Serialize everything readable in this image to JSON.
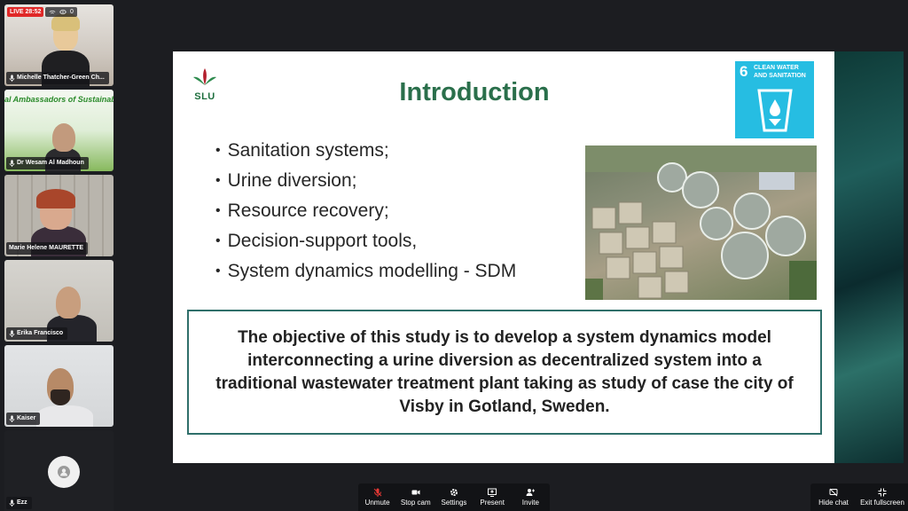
{
  "live": {
    "badge": "LIVE 28:52",
    "viewers": "0"
  },
  "participants": [
    {
      "name": "Michelle Thatcher-Green Ch..."
    },
    {
      "name": "Dr Wesam Al Madhoun",
      "banner": "al Ambassadors of Sustainab"
    },
    {
      "name": "Marie Helene MAURETTE"
    },
    {
      "name": "Erika Francisco"
    },
    {
      "name": "Kaiser"
    },
    {
      "name": "Ezz"
    }
  ],
  "slide": {
    "logo_text": "SLU",
    "title": "Introduction",
    "sdg": {
      "number": "6",
      "label": "CLEAN WATER AND SANITATION"
    },
    "bullets": [
      "Sanitation systems;",
      "Urine diversion;",
      "Resource recovery;",
      "Decision-support tools,",
      "System dynamics modelling - SDM"
    ],
    "objective": "The objective of this study is to develop a system dynamics model interconnecting a urine diversion as decentralized system into a traditional wastewater treatment plant taking as study of case the city of Visby in Gotland, Sweden."
  },
  "toolbar": {
    "unmute": "Unmute",
    "stop_cam": "Stop cam",
    "settings": "Settings",
    "present": "Present",
    "invite": "Invite",
    "hide_chat": "Hide chat",
    "exit_fullscreen": "Exit fullscreen"
  },
  "colors": {
    "muted_mic": "#e53935",
    "title_green": "#2a6f4b",
    "sdg_blue": "#26bde2"
  }
}
